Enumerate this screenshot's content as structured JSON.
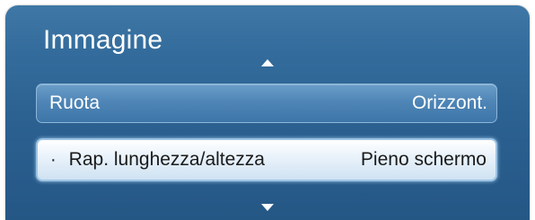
{
  "menu": {
    "title": "Immagine",
    "items": [
      {
        "label": "Ruota",
        "value": "Orizzont.",
        "selected": false
      },
      {
        "label": "Rap. lunghezza/altezza",
        "value": "Pieno schermo",
        "selected": true,
        "bullet": "·"
      }
    ],
    "scroll_up_icon": "triangle-up",
    "scroll_down_icon": "triangle-down"
  },
  "colors": {
    "panel": "#2f6696",
    "item_normal": "#4f86b7",
    "item_selected": "#eaf3fb"
  }
}
